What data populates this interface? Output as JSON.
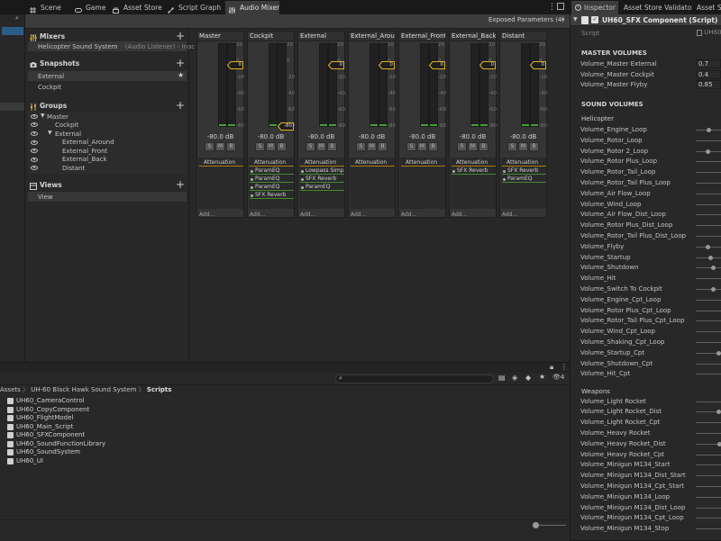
{
  "tabs": [
    {
      "label": "Scene",
      "icon": "hash-icon"
    },
    {
      "label": "Game",
      "icon": "gamepad-icon"
    },
    {
      "label": "Asset Store",
      "icon": "store-icon"
    },
    {
      "label": "Script Graph",
      "icon": "graph-icon"
    },
    {
      "label": "Audio Mixer",
      "icon": "mixer-icon"
    }
  ],
  "toolbar": {
    "exposed": "Exposed Parameters (4)"
  },
  "mixers": {
    "title": "Mixers",
    "items": [
      {
        "name": "Helicopter Sound System",
        "note": "(Audio Listener) - Inac"
      }
    ]
  },
  "snapshots": {
    "title": "Snapshots",
    "items": [
      "External",
      "Cockpit"
    ]
  },
  "groups": {
    "title": "Groups",
    "items": [
      "Master",
      "Cockpit",
      "External",
      "External_Around",
      "External_Front",
      "External_Back",
      "Distant"
    ]
  },
  "views": {
    "title": "Views",
    "items": [
      "View"
    ]
  },
  "scale_labels": [
    "20",
    "0",
    "-20",
    "-40",
    "-60",
    "-80"
  ],
  "strips": [
    {
      "name": "Master",
      "db": "-80.0 dB",
      "fader": "0",
      "effects": [],
      "add": "Add..."
    },
    {
      "name": "Cockpit",
      "db": "-80.0 dB",
      "fader": "-80",
      "effects": [
        "ParamEQ",
        "ParamEQ",
        "ParamEQ",
        "SFX Reverb"
      ],
      "add": "Add..."
    },
    {
      "name": "External",
      "db": "-80.0 dB",
      "fader": "0",
      "effects": [
        "Lowpass Simp",
        "SFX Reverb",
        "ParamEQ"
      ],
      "add": "Add..."
    },
    {
      "name": "External_Arou",
      "db": "-80.0 dB",
      "fader": "0",
      "effects": [],
      "add": "Add..."
    },
    {
      "name": "External_Front",
      "db": "-80.0 dB",
      "fader": "0",
      "effects": [],
      "add": "Add..."
    },
    {
      "name": "External_Back",
      "db": "-80.0 dB",
      "fader": "0",
      "effects": [
        "SFX Reverb"
      ],
      "add": "Add..."
    },
    {
      "name": "Distant",
      "db": "-80.0 dB",
      "fader": "0",
      "effects": [
        "SFX Reverb",
        "ParamEQ"
      ],
      "add": "Add..."
    }
  ],
  "strip_common": {
    "attenuation": "Attenuation",
    "s": "S",
    "m": "M",
    "b": "B"
  },
  "project": {
    "breadcrumb": [
      "Assets",
      "UH-60 Black Hawk Sound System",
      "Scripts"
    ],
    "badge": "4",
    "files": [
      "UH60_CameraControl",
      "UH60_CopyComponent",
      "UH60_FlightModel",
      "UH60_Main_Script",
      "UH60_SFXComponent",
      "UH60_SoundFunctionLibrary",
      "UH60_SoundSystem",
      "UH60_UI"
    ]
  },
  "inspector": {
    "tabs": [
      "Inspector",
      "Asset Store Validator",
      "Asset S"
    ],
    "component": "UH60_SFX Component (Script)",
    "script_label": "Script",
    "script_value": "UH60",
    "master_header": "MASTER VOLUMES",
    "master": [
      {
        "label": "Volume_Master External",
        "value": "0.7"
      },
      {
        "label": "Volume_Master Cockpit",
        "value": "0.4"
      },
      {
        "label": "Volume_Master Flyby",
        "value": "0.85"
      }
    ],
    "sound_header": "SOUND VOLUMES",
    "heli_header": "Helicopter",
    "heli": [
      {
        "label": "Volume_Engine_Loop",
        "knob": 0.5
      },
      {
        "label": "Volume_Rotor_Loop",
        "knob": null
      },
      {
        "label": "Volume_Rotor 2_Loop",
        "knob": 0.45
      },
      {
        "label": "Volume_Rotor Plus_Loop",
        "knob": null
      },
      {
        "label": "Volume_Rotor_Tail_Loop",
        "knob": null
      },
      {
        "label": "Volume_Rotor_Tail Plus_Loop",
        "knob": null
      },
      {
        "label": "Volume_Air Flow_Loop",
        "knob": null
      },
      {
        "label": "Volume_Wind_Loop",
        "knob": null
      },
      {
        "label": "Volume_Air Flow_Dist_Loop",
        "knob": null
      },
      {
        "label": "Volume_Rotor Plus_Dist_Loop",
        "knob": null
      },
      {
        "label": "Volume_Rotor_Tail Plus_Dist_Loop",
        "knob": null
      },
      {
        "label": "Volume_Flyby",
        "knob": 0.45
      },
      {
        "label": "Volume_Startup",
        "knob": 0.6
      },
      {
        "label": "Volume_Shutdown",
        "knob": 0.7
      },
      {
        "label": "Volume_Hit",
        "knob": null
      },
      {
        "label": "Volume_Switch To Cockpit",
        "knob": 0.7
      },
      {
        "label": "Volume_Engine_Cpt_Loop",
        "knob": null
      },
      {
        "label": "Volume_Rotor Plus_Cpt_Loop",
        "knob": null
      },
      {
        "label": "Volume_Rotor_Tail Plus_Cpt_Loop",
        "knob": null
      },
      {
        "label": "Volume_Wind_Cpt_Loop",
        "knob": null
      },
      {
        "label": "Volume_Shaking_Cpt_Loop",
        "knob": null
      },
      {
        "label": "Volume_Startup_Cpt",
        "knob": 0.95
      },
      {
        "label": "Volume_Shutdown_Cpt",
        "knob": null
      },
      {
        "label": "Volume_Hit_Cpt",
        "knob": null
      }
    ],
    "weapons_header": "Weapons",
    "weapons": [
      {
        "label": "Volume_Light Rocket",
        "knob": null
      },
      {
        "label": "Volume_Light Rocket_Dist",
        "knob": 0.95
      },
      {
        "label": "Volume_Light Rocket_Cpt",
        "knob": null
      },
      {
        "label": "Volume_Heavy Rocket",
        "knob": null
      },
      {
        "label": "Volume_Heavy Rocket_Dist",
        "knob": 1.0
      },
      {
        "label": "Volume_Heavy Rocket_Cpt",
        "knob": null
      },
      {
        "label": "Volume_Minigun M134_Start",
        "knob": null
      },
      {
        "label": "Volume_Minigun M134_Dist_Start",
        "knob": null
      },
      {
        "label": "Volume_Minigun M134_Cpt_Start",
        "knob": null
      },
      {
        "label": "Volume_Minigun M134_Loop",
        "knob": null
      },
      {
        "label": "Volume_Minigun M134_Dist_Loop",
        "knob": null
      },
      {
        "label": "Volume_Minigun M134_Cpt_Loop",
        "knob": null
      },
      {
        "label": "Volume_Minigun M134_Stop",
        "knob": null
      }
    ]
  },
  "colors": {
    "accent_green": "#3f8f2f",
    "accent_orange": "#b07a10",
    "fader_yellow": "#e0b020"
  }
}
